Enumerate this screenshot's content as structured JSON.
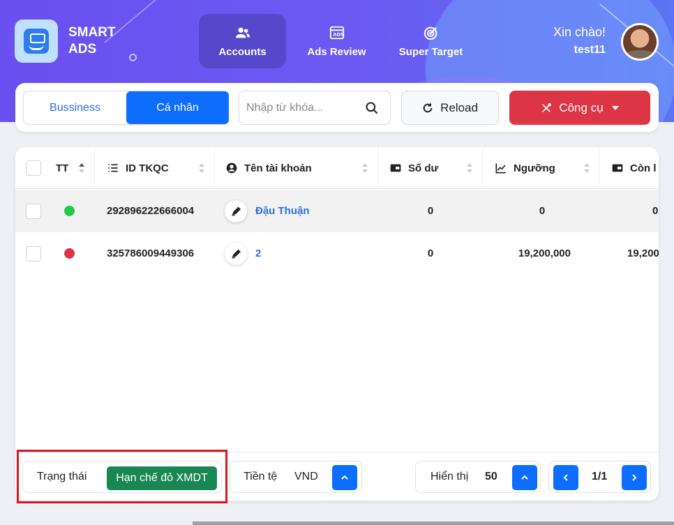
{
  "brand": {
    "line1": "SMART",
    "line2": "ADS",
    "logo_icon": "ads-hand-icon"
  },
  "nav": [
    {
      "label": "Accounts",
      "icon": "users-icon",
      "active": true
    },
    {
      "label": "Ads Review",
      "icon": "ads-window-icon",
      "active": false
    },
    {
      "label": "Super Target",
      "icon": "target-icon",
      "active": false
    }
  ],
  "user": {
    "greeting": "Xin chào!",
    "name": "test11"
  },
  "toolbar": {
    "tab_business": "Bussiness",
    "tab_personal": "Cá nhân",
    "search_placeholder": "Nhập từ khóa...",
    "reload_label": "Reload",
    "tools_label": "Công cụ",
    "tools_color": "#dc3545",
    "primary_color": "#0d6efd"
  },
  "table": {
    "columns": [
      "TT",
      "ID TKQC",
      "Tên tài khoản",
      "Số dư",
      "Ngưỡng",
      "Còn l"
    ],
    "rows": [
      {
        "status_color": "#22cc44",
        "id": "292896222666004",
        "name": "Đậu Thuận",
        "balance": "0",
        "threshold": "0",
        "remaining": "0"
      },
      {
        "status_color": "#dc3545",
        "id": "325786009449306",
        "name": "2",
        "balance": "0",
        "threshold": "19,200,000",
        "remaining": "19,200"
      }
    ]
  },
  "footer": {
    "status_label": "Trạng thái",
    "status_value": "Hạn chế đỏ XMDT",
    "status_color": "#198754",
    "currency_label": "Tiền tệ",
    "currency_value": "VND",
    "display_label": "Hiển thị",
    "display_value": "50",
    "page": "1/1"
  }
}
